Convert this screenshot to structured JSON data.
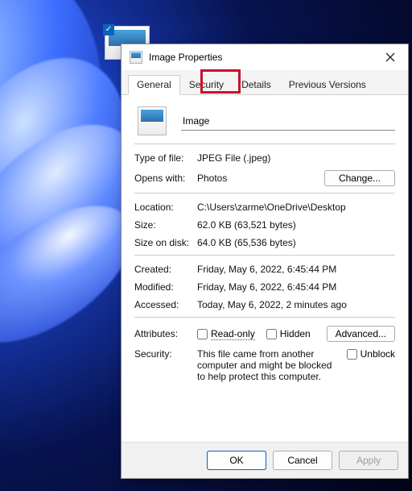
{
  "window": {
    "title": "Image Properties",
    "filename": "Image"
  },
  "tabs": {
    "general": "General",
    "security": "Security",
    "details": "Details",
    "previous": "Previous Versions"
  },
  "labels": {
    "type_of_file": "Type of file:",
    "opens_with": "Opens with:",
    "location": "Location:",
    "size": "Size:",
    "size_on_disk": "Size on disk:",
    "created": "Created:",
    "modified": "Modified:",
    "accessed": "Accessed:",
    "attributes": "Attributes:",
    "security": "Security:"
  },
  "values": {
    "type_of_file": "JPEG File (.jpeg)",
    "opens_with": "Photos",
    "location": "C:\\Users\\zarme\\OneDrive\\Desktop",
    "size": "62.0 KB (63,521 bytes)",
    "size_on_disk": "64.0 KB (65,536 bytes)",
    "created": "Friday, May 6, 2022, 6:45:44 PM",
    "modified": "Friday, May 6, 2022, 6:45:44 PM",
    "accessed": "Today, May 6, 2022, 2 minutes ago",
    "security_msg": "This file came from another computer and might be blocked to help protect this computer."
  },
  "buttons": {
    "change": "Change...",
    "advanced": "Advanced...",
    "ok": "OK",
    "cancel": "Cancel",
    "apply": "Apply"
  },
  "checkboxes": {
    "read_only": "Read-only",
    "hidden": "Hidden",
    "unblock": "Unblock"
  }
}
